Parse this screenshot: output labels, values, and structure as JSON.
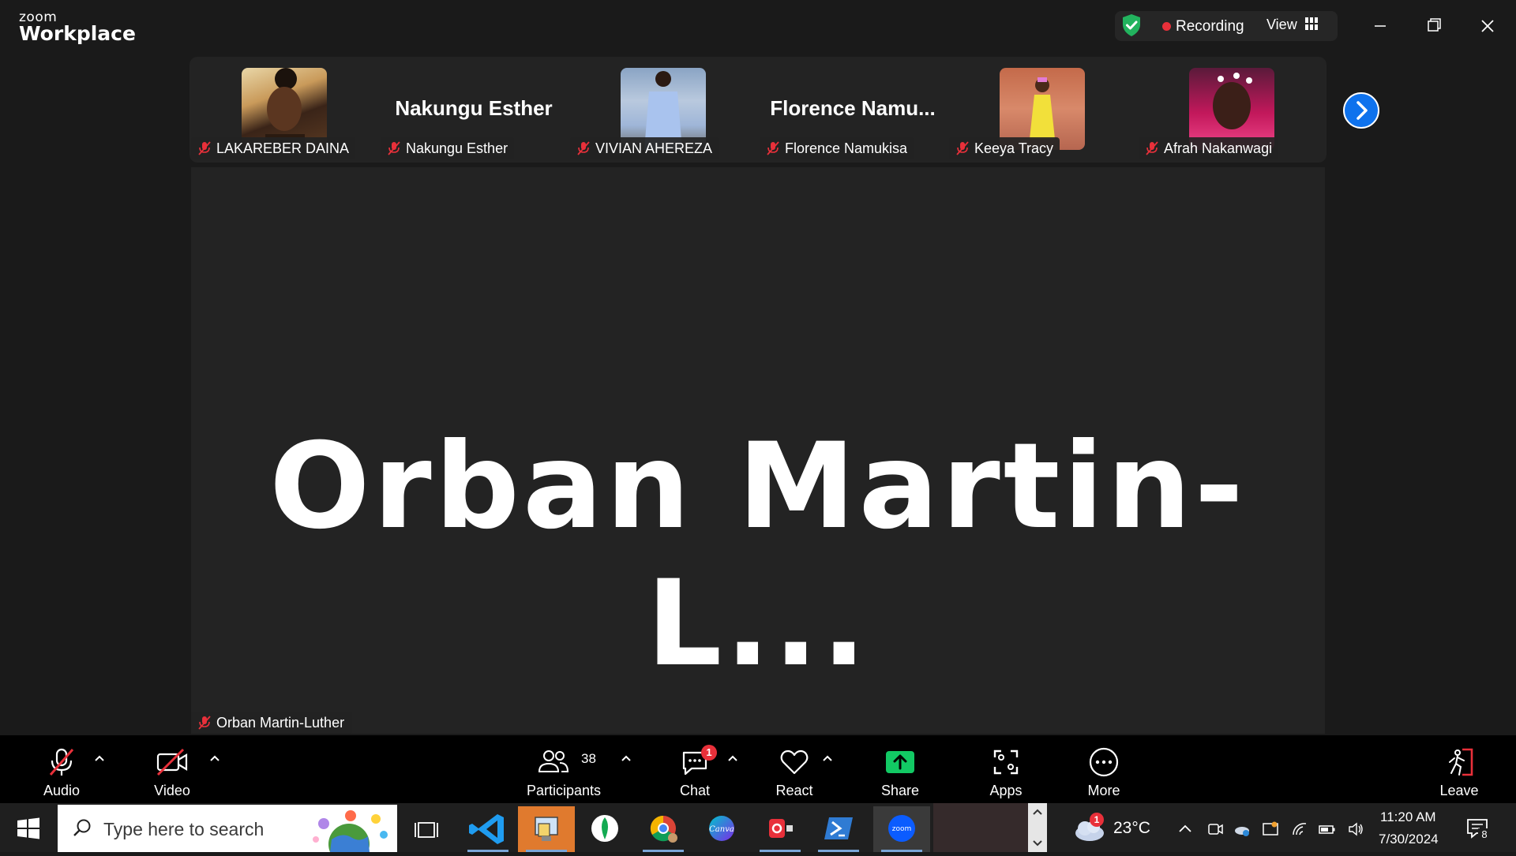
{
  "app": {
    "logo_top": "zoom",
    "logo_product": "Workplace"
  },
  "titlebar": {
    "recording_label": "Recording",
    "view_label": "View"
  },
  "gallery": {
    "tiles": [
      {
        "name": "LAKAREBER DAINA",
        "has_photo": true,
        "big_name": ""
      },
      {
        "name": "Nakungu Esther",
        "has_photo": false,
        "big_name": "Nakungu Esther"
      },
      {
        "name": "VIVIAN AHEREZA",
        "has_photo": true,
        "big_name": ""
      },
      {
        "name": "Florence Namukisa",
        "has_photo": false,
        "big_name": "Florence  Namu..."
      },
      {
        "name": "Keeya Tracy",
        "has_photo": true,
        "big_name": ""
      },
      {
        "name": "Afrah Nakanwagi",
        "has_photo": true,
        "big_name": ""
      }
    ]
  },
  "speaker": {
    "display_name": "Orban Martin-L...",
    "name_tag": "Orban Martin-Luther"
  },
  "toolbar": {
    "audio": "Audio",
    "video": "Video",
    "participants": "Participants",
    "participants_count": "38",
    "chat": "Chat",
    "chat_badge": "1",
    "react": "React",
    "share": "Share",
    "apps": "Apps",
    "more": "More",
    "leave": "Leave"
  },
  "taskbar": {
    "search_placeholder": "Type here to search",
    "temperature": "23°C",
    "time": "11:20 AM",
    "date": "7/30/2024",
    "notification_count": "8",
    "weather_badge": "1"
  },
  "colors": {
    "accent": "#0e72ed",
    "share_green": "#12c964",
    "mute_red": "#e8303a",
    "leave_red": "#e8303a"
  }
}
